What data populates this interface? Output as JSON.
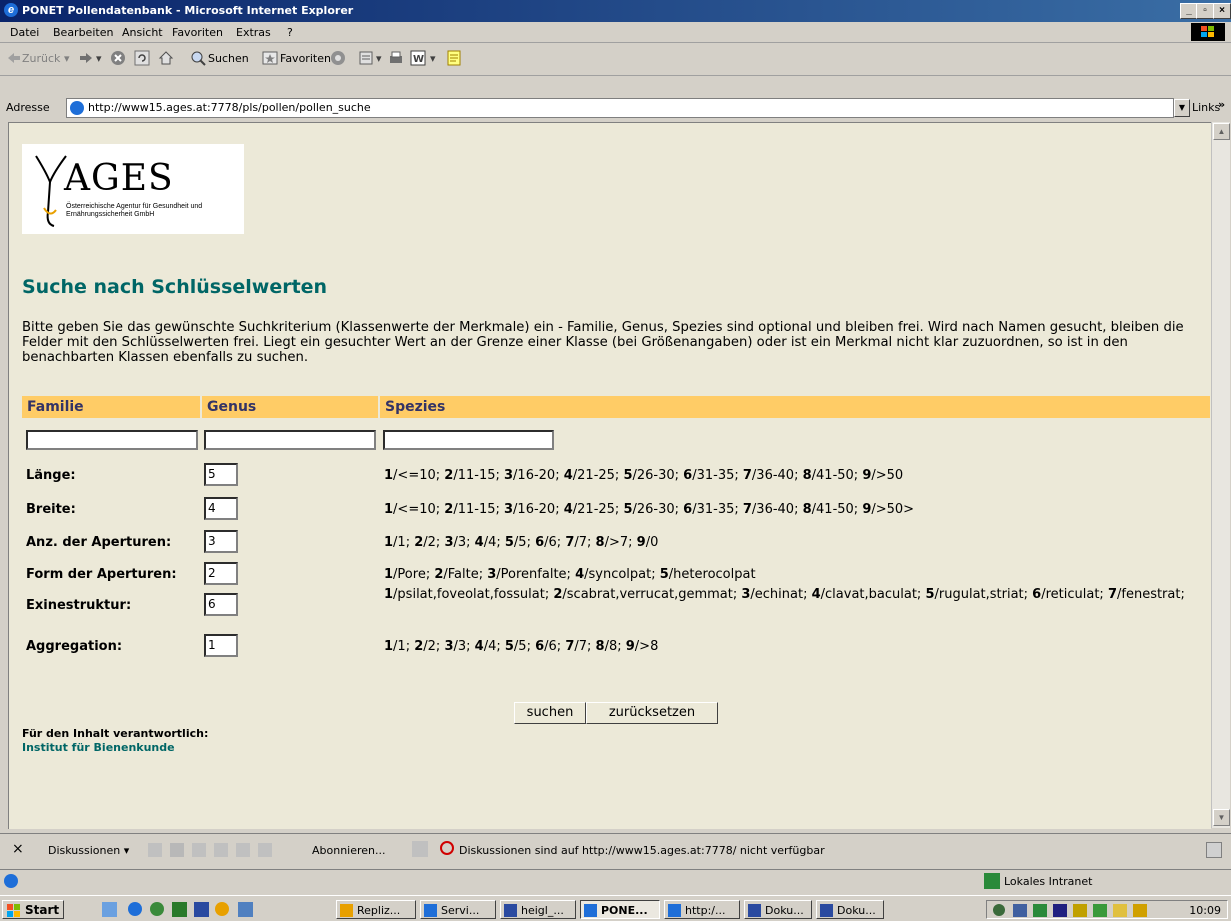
{
  "window": {
    "title": "PONET Pollendatenbank - Microsoft Internet Explorer",
    "min": "_",
    "max": "▫",
    "close": "×"
  },
  "menu": [
    "Datei",
    "Bearbeiten",
    "Ansicht",
    "Favoriten",
    "Extras",
    "?"
  ],
  "toolbar": {
    "back": "Zurück",
    "search": "Suchen",
    "favorites": "Favoriten"
  },
  "address": {
    "label": "Adresse",
    "url": "http://www15.ages.at:7778/pls/pollen/pollen_suche",
    "links": "Links"
  },
  "logo": {
    "name": "AGES",
    "subtitle": "Österreichische Agentur für Gesundheit und Ernährungssicherheit GmbH"
  },
  "page": {
    "heading": "Suche nach Schlüsselwerten",
    "intro": "Bitte geben Sie das gewünschte Suchkriterium (Klassenwerte der Merkmale) ein - Familie, Genus, Spezies sind optional und bleiben frei. Wird nach Namen gesucht, bleiben die Felder mit den Schlüsselwerten frei. Liegt ein gesuchter Wert an der Grenze einer Klasse (bei Größenangaben) oder ist ein Merkmal nicht klar zuzuordnen, so ist in den benachbarten Klassen ebenfalls zu suchen."
  },
  "table": {
    "headers": [
      "Familie",
      "Genus",
      "Spezies"
    ],
    "rows": [
      {
        "label": "Länge:",
        "value": "5",
        "options": [
          [
            "1",
            "/<=10; "
          ],
          [
            "2",
            "/11-15; "
          ],
          [
            "3",
            "/16-20; "
          ],
          [
            "4",
            "/21-25; "
          ],
          [
            "5",
            "/26-30; "
          ],
          [
            "6",
            "/31-35; "
          ],
          [
            "7",
            "/36-40; "
          ],
          [
            "8",
            "/41-50; "
          ],
          [
            "9",
            "/>50"
          ]
        ]
      },
      {
        "label": "Breite:",
        "value": "4",
        "options": [
          [
            "1",
            "/<=10; "
          ],
          [
            "2",
            "/11-15; "
          ],
          [
            "3",
            "/16-20; "
          ],
          [
            "4",
            "/21-25; "
          ],
          [
            "5",
            "/26-30; "
          ],
          [
            "6",
            "/31-35; "
          ],
          [
            "7",
            "/36-40; "
          ],
          [
            "8",
            "/41-50; "
          ],
          [
            "9",
            "/>50>"
          ]
        ]
      },
      {
        "label": "Anz. der Aperturen:",
        "value": "3",
        "options": [
          [
            "1",
            "/1; "
          ],
          [
            "2",
            "/2; "
          ],
          [
            "3",
            "/3; "
          ],
          [
            "4",
            "/4; "
          ],
          [
            "5",
            "/5; "
          ],
          [
            "6",
            "/6; "
          ],
          [
            "7",
            "/7; "
          ],
          [
            "8",
            "/>7; "
          ],
          [
            "9",
            "/0"
          ]
        ]
      },
      {
        "label": "Form der Aperturen:",
        "value": "2",
        "options": [
          [
            "1",
            "/Pore; "
          ],
          [
            "2",
            "/Falte; "
          ],
          [
            "3",
            "/Porenfalte; "
          ],
          [
            "4",
            "/syncolpat; "
          ],
          [
            "5",
            "/heterocolpat"
          ]
        ]
      },
      {
        "label": "Exinestruktur:",
        "value": "6",
        "options": [
          [
            "1",
            "/psilat,foveolat,fossulat; "
          ],
          [
            "2",
            "/scabrat,verrucat,gemmat; "
          ],
          [
            "3",
            "/echinat; "
          ],
          [
            "4",
            "/clavat,baculat; "
          ],
          [
            "5",
            "/rugulat,striat; "
          ],
          [
            "6",
            "/reticulat; "
          ],
          [
            "7",
            "/fenestrat;"
          ]
        ]
      },
      {
        "label": "Aggregation:",
        "value": "1",
        "options": [
          [
            "1",
            "/1; "
          ],
          [
            "2",
            "/2; "
          ],
          [
            "3",
            "/3; "
          ],
          [
            "4",
            "/4; "
          ],
          [
            "5",
            "/5; "
          ],
          [
            "6",
            "/6; "
          ],
          [
            "7",
            "/7; "
          ],
          [
            "8",
            "/8; "
          ],
          [
            "9",
            "/>8"
          ]
        ]
      }
    ]
  },
  "buttons": {
    "search": "suchen",
    "reset": "zurücksetzen"
  },
  "footer": {
    "responsible": "Für den Inhalt verantwortlich:",
    "institute": "Institut für Bienenkunde"
  },
  "discussion": {
    "close": "×",
    "label": "Diskussionen ▾",
    "subscribe": "Abonnieren...",
    "message": "Diskussionen sind auf http://www15.ages.at:7778/ nicht verfügbar"
  },
  "status": {
    "zone": "Lokales Intranet"
  },
  "taskbar": {
    "start": "Start",
    "tasks": [
      "Repliz...",
      "Servi...",
      "heigl_...",
      "PONE...",
      "http:/...",
      "Doku...",
      "Doku..."
    ],
    "active_index": 3,
    "clock": "10:09"
  },
  "colors": {
    "accent": "#ffcc66",
    "heading": "#006666",
    "page_bg": "#ece9d8"
  }
}
